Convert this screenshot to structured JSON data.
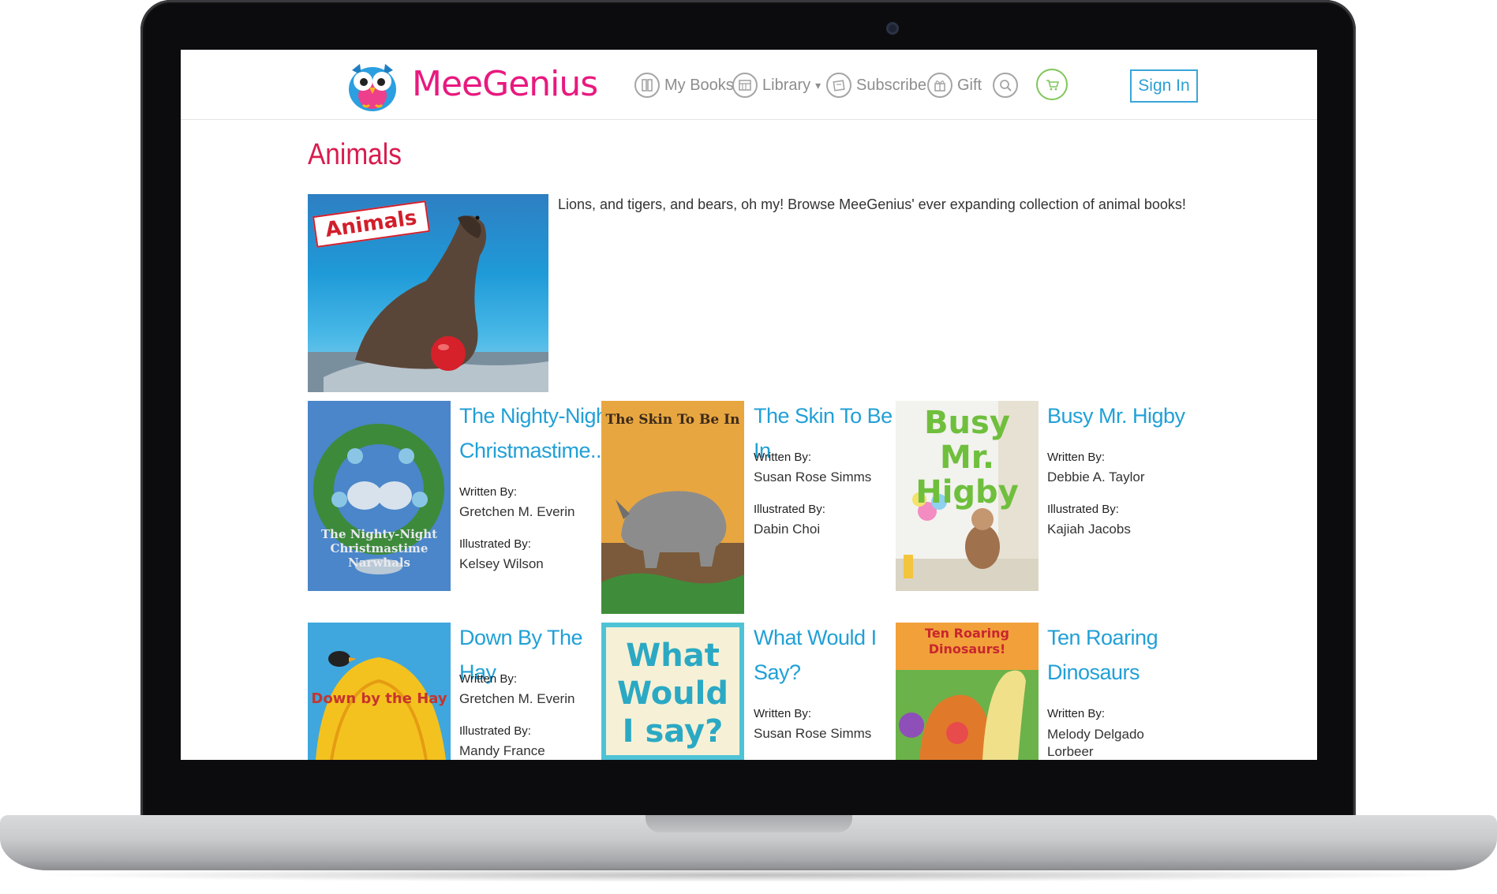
{
  "brand": {
    "name": "MeeGenius",
    "pink": "#e8197f",
    "blue": "#21a0d6",
    "title_red": "#d81c4e"
  },
  "nav": [
    {
      "label": "My Books",
      "icon": "book-icon"
    },
    {
      "label": "Library",
      "icon": "library-icon",
      "caret": "▾"
    },
    {
      "label": "Subscribe",
      "icon": "subscribe-icon"
    },
    {
      "label": "Gift",
      "icon": "gift-icon"
    },
    {
      "label": "",
      "icon": "search-icon"
    },
    {
      "label": "",
      "icon": "cart-icon"
    }
  ],
  "signin_label": "Sign In",
  "page": {
    "title": "Animals",
    "hero_label": "Animals",
    "intro": "Lions, and tigers, and bears, oh my! Browse MeeGenius' ever expanding collection of animal books!"
  },
  "labels": {
    "written_by": "Written By:",
    "illustrated_by": "Illustrated By:"
  },
  "books": [
    {
      "title": "The Nighty-Night Christmastime...",
      "author": "Gretchen M. Everin",
      "illustrator": "Kelsey Wilson",
      "cover_text": "The Nighty-Night Christmastime Narwhals",
      "cover_color": "#4a86c9"
    },
    {
      "title": "The Skin To Be In",
      "author": "Susan Rose Simms",
      "illustrator": "Dabin Choi",
      "cover_text": "The Skin To Be In",
      "cover_color": "#e8a640"
    },
    {
      "title": "Busy Mr. Higby",
      "author": "Debbie A. Taylor",
      "illustrator": "Kajiah Jacobs",
      "cover_text": "Busy Mr. Higby",
      "cover_color": "#f2f2ee"
    },
    {
      "title": "Down By The Hay",
      "author": "Gretchen M. Everin",
      "illustrator": "Mandy France",
      "cover_text": "Down by the Hay",
      "cover_color": "#3fa7dd"
    },
    {
      "title": "What Would I Say?",
      "author": "Susan Rose Simms",
      "illustrator": "",
      "cover_text": "What Would I say?",
      "cover_color": "#f6f1d6"
    },
    {
      "title": "Ten Roaring Dinosaurs",
      "author": "Melody Delgado Lorbeer",
      "illustrator": "",
      "cover_text": "Ten Roaring Dinosaurs!",
      "cover_color": "#6bb24a"
    }
  ]
}
